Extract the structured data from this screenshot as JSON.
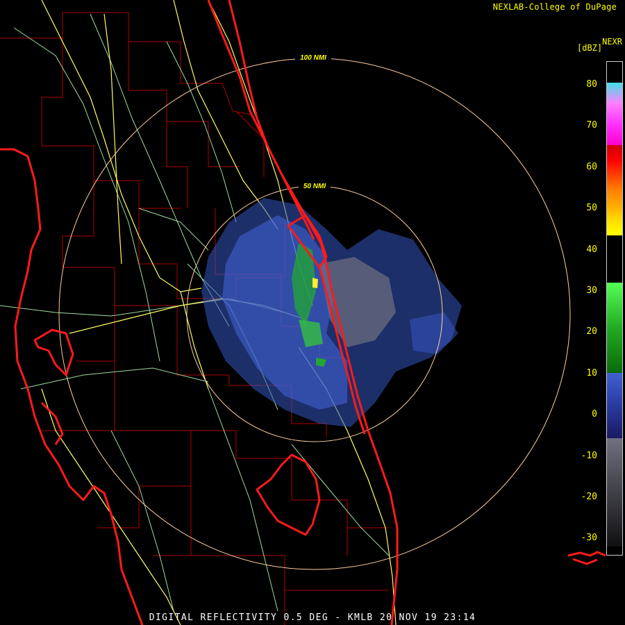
{
  "credit": "NEXLAB-College of DuPage",
  "product": "NEXR",
  "units": "[dBZ]",
  "footer": "DIGITAL REFLECTIVITY 0.5 DEG - KMLB 20 NOV 19 23:14",
  "range_rings": [
    {
      "label": "100 NMI"
    },
    {
      "label": "50 NMI"
    }
  ],
  "legend_ticks": [
    "80",
    "70",
    "60",
    "50",
    "40",
    "30",
    "20",
    "10",
    "0",
    "-10",
    "-20",
    "-30"
  ],
  "colors": {
    "coast": "#ff1a1a",
    "county": "#c00000",
    "highway": "#ffff66",
    "road": "#a0e0a0",
    "ring": "#ffd0a0",
    "text": "#ffff00"
  }
}
